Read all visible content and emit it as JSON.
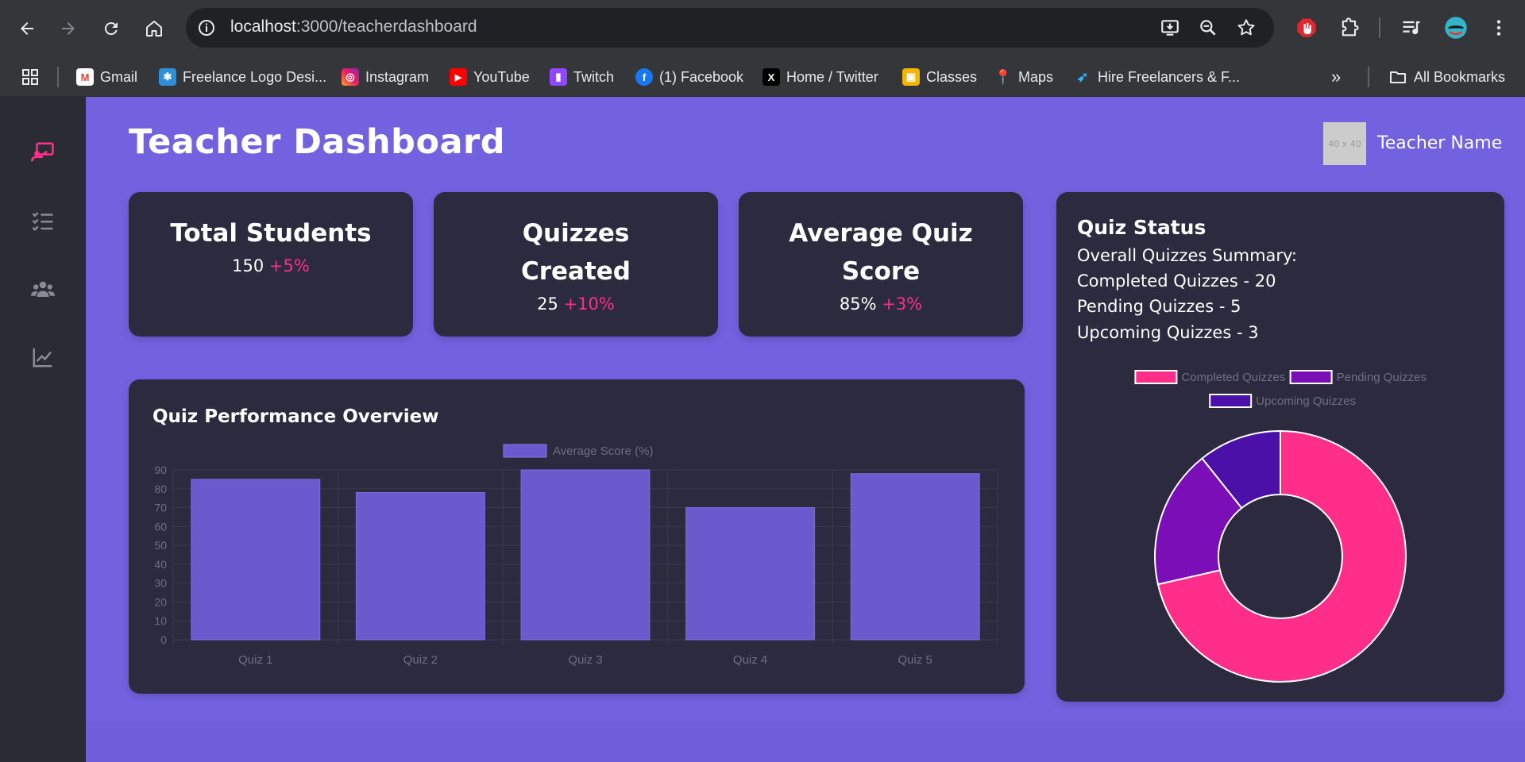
{
  "browser": {
    "url_host": "localhost",
    "url_path": ":3000/teacherdashboard",
    "bookmarks": [
      {
        "label": "Gmail",
        "icon": "gmail-icon"
      },
      {
        "label": "Freelance Logo Desi...",
        "icon": "freelance-logo-icon"
      },
      {
        "label": "Instagram",
        "icon": "instagram-icon"
      },
      {
        "label": "YouTube",
        "icon": "youtube-icon"
      },
      {
        "label": "Twitch",
        "icon": "twitch-icon"
      },
      {
        "label": "(1) Facebook",
        "icon": "facebook-icon"
      },
      {
        "label": "Home / Twitter",
        "icon": "x-twitter-icon"
      },
      {
        "label": "Classes",
        "icon": "classes-icon"
      },
      {
        "label": "Maps",
        "icon": "maps-icon"
      },
      {
        "label": "Hire Freelancers & F...",
        "icon": "freelancer-bird-icon"
      }
    ],
    "all_bookmarks_label": "All Bookmarks"
  },
  "sidebar": {
    "items": [
      {
        "icon": "teacher-board-icon",
        "active": true
      },
      {
        "icon": "checklist-icon",
        "active": false
      },
      {
        "icon": "users-icon",
        "active": false
      },
      {
        "icon": "line-chart-icon",
        "active": false
      }
    ]
  },
  "header": {
    "title": "Teacher Dashboard",
    "avatar_placeholder": "40 x 40",
    "teacher_name": "Teacher Name"
  },
  "stats": [
    {
      "title": "Total Students",
      "value": "150",
      "delta": "+5%"
    },
    {
      "title": "Quizzes Created",
      "value": "25",
      "delta": "+10%"
    },
    {
      "title": "Average Quiz Score",
      "value": "85%",
      "delta": "+3%"
    }
  ],
  "quiz_status": {
    "title": "Quiz Status",
    "summary_heading": "Overall Quizzes Summary:",
    "lines": [
      "Completed Quizzes - 20",
      "Pending Quizzes - 5",
      "Upcoming Quizzes - 3"
    ]
  },
  "performance": {
    "title": "Quiz Performance Overview"
  },
  "colors": {
    "accent_pink": "#ff2e8a",
    "bar_purple": "#6a5acd",
    "pending_purple": "#7a0fb8",
    "upcoming_purple": "#4a10a8"
  },
  "chart_data": [
    {
      "type": "bar",
      "categories": [
        "Quiz 1",
        "Quiz 2",
        "Quiz 3",
        "Quiz 4",
        "Quiz 5"
      ],
      "series": [
        {
          "name": "Average Score (%)",
          "values": [
            85,
            78,
            90,
            70,
            88
          ]
        }
      ],
      "ylim": [
        0,
        90
      ],
      "yticks": [
        0,
        10,
        20,
        30,
        40,
        50,
        60,
        70,
        80,
        90
      ],
      "grid": true,
      "legend": "top-center"
    },
    {
      "type": "pie",
      "variant": "doughnut",
      "labels": [
        "Completed Quizzes",
        "Pending Quizzes",
        "Upcoming Quizzes"
      ],
      "values": [
        20,
        5,
        3
      ],
      "legend": "top-center"
    }
  ]
}
